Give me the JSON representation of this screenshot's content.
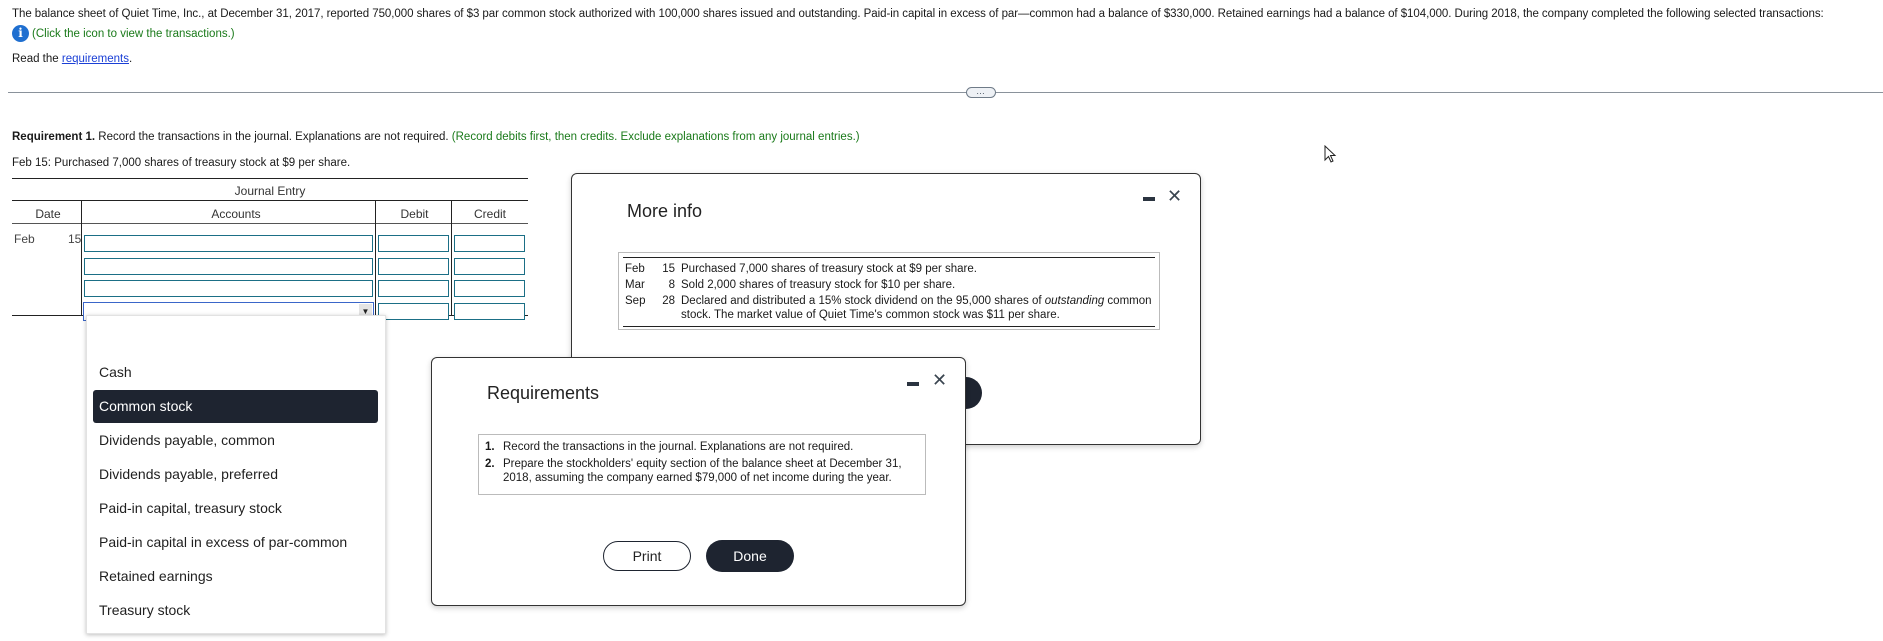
{
  "intro": {
    "text": "The balance sheet of Quiet Time, Inc., at December 31, 2017, reported 750,000 shares of $3 par common stock authorized with 100,000 shares issued and outstanding. Paid-in capital in excess of par—common had a balance of $330,000. Retained earnings had a balance of $104,000. During 2018, the company completed the following selected transactions:",
    "click_hint": "(Click the icon to view the transactions.)",
    "info_icon": "info-icon",
    "read_prefix": "Read the ",
    "read_link": "requirements",
    "read_suffix": "."
  },
  "divider": {
    "expand_label": "…"
  },
  "requirement1": {
    "bold": "Requirement 1.",
    "text": " Record the transactions in the journal. Explanations are not required. ",
    "hint": "(Record debits first, then credits. Exclude explanations from any journal entries.)"
  },
  "transaction_prompt": "Feb 15: Purchased 7,000 shares of treasury stock at $9 per share.",
  "journal": {
    "title": "Journal Entry",
    "headers": {
      "date": "Date",
      "accounts": "Accounts",
      "debit": "Debit",
      "credit": "Credit"
    },
    "date_month": "Feb",
    "date_day": "15",
    "rows": [
      {
        "account": "",
        "debit": "",
        "credit": ""
      },
      {
        "account": "",
        "debit": "",
        "credit": ""
      },
      {
        "account": "",
        "debit": "",
        "credit": ""
      },
      {
        "account": "",
        "debit": "",
        "credit": ""
      }
    ]
  },
  "dropdown": {
    "options": [
      "Cash",
      "Common stock",
      "Dividends payable, common",
      "Dividends payable, preferred",
      "Paid-in capital, treasury stock",
      "Paid-in capital in excess of par-common",
      "Retained earnings",
      "Treasury stock"
    ],
    "highlighted": "Common stock"
  },
  "more_info": {
    "title": "More info",
    "minimize": "minimize-icon",
    "close": "✕",
    "transactions": [
      {
        "month": "Feb",
        "day": "15",
        "text": "Purchased 7,000 shares of treasury stock at $9 per share."
      },
      {
        "month": "Mar",
        "day": "8",
        "text": "Sold 2,000 shares of treasury stock for $10 per share."
      },
      {
        "month": "Sep",
        "day": "28",
        "text_before": "Declared and distributed a 15% stock dividend on the 95,000 shares of ",
        "text_italic": "outstanding",
        "text_after": " common stock. The market value of Quiet Time's common stock was $11 per share."
      }
    ]
  },
  "requirements_dialog": {
    "title": "Requirements",
    "close": "✕",
    "items": [
      {
        "num": "1.",
        "text": "Record the transactions in the journal. Explanations are not required."
      },
      {
        "num": "2.",
        "text": "Prepare the stockholders' equity section of the balance sheet at December 31, 2018, assuming the company earned $79,000 of net income during the year."
      }
    ],
    "print_label": "Print",
    "done_label": "Done"
  },
  "colors": {
    "accent_dark": "#1e2430",
    "link": "#1a3fd6",
    "hint_green": "#1a7a1a",
    "input_border": "#1b6f86",
    "info_icon": "#1f6fd0"
  }
}
